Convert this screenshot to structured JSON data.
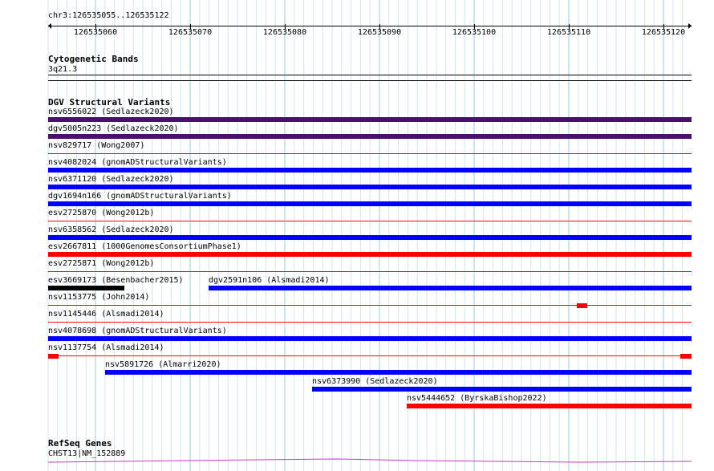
{
  "ruler": {
    "location": "chr3:126535055..126535122",
    "ticks": [
      "126535060",
      "126535070",
      "126535080",
      "126535090",
      "126535100",
      "126535110",
      "126535120"
    ]
  },
  "cytoband": {
    "title": "Cytogenetic Bands",
    "band": "3q21.3"
  },
  "dgv": {
    "title": "DGV Structural Variants",
    "features": [
      {
        "label": "nsv6556022 (Sedlazeck2020)",
        "color": "#4b0f6e",
        "style": "thick"
      },
      {
        "label": "dgv5005n223 (Sedlazeck2020)",
        "color": "#4b0f6e",
        "style": "thick"
      },
      {
        "label": "nsv829717 (Wong2007)",
        "color": "#ff0000",
        "style": "thin"
      },
      {
        "label": "nsv4082024 (gnomADStructuralVariants)",
        "color": "#0000ff",
        "style": "thick"
      },
      {
        "label": "nsv6371120 (Sedlazeck2020)",
        "color": "#0000ff",
        "style": "thick"
      },
      {
        "label": "dgv1694n166 (gnomADStructuralVariants)",
        "color": "#0000ff",
        "style": "thick"
      },
      {
        "label": "esv2725870 (Wong2012b)",
        "color": "#ff0000",
        "style": "thin"
      },
      {
        "label": "nsv6358562 (Sedlazeck2020)",
        "color": "#0000ff",
        "style": "thick"
      },
      {
        "label": "esv2667811 (1000GenomesConsortiumPhase1)",
        "color": "#ff0000",
        "style": "thick"
      },
      {
        "label": "esv2725871 (Wong2012b)",
        "color": "#ff0000",
        "style": "thin"
      },
      {
        "label": "esv3669173 (Besenbacher2015)",
        "color": "#000000",
        "style": "thick"
      },
      {
        "label": "dgv2591n106 (Alsmadi2014)",
        "color": "#0000ff",
        "style": "thick"
      },
      {
        "label": "nsv1153775 (John2014)",
        "color": "#ff0000",
        "style": "thin-end"
      },
      {
        "label": "nsv1145446 (Alsmadi2014)",
        "color": "#ff0000",
        "style": "thin"
      },
      {
        "label": "nsv4078698 (gnomADStructuralVariants)",
        "color": "#0000ff",
        "style": "thick"
      },
      {
        "label": "nsv1137754 (Alsmadi2014)",
        "color": "#ff0000",
        "style": "thin-ends"
      },
      {
        "label": "nsv5891726 (Almarri2020)",
        "color": "#0000ff",
        "style": "thick"
      },
      {
        "label": "nsv6373990 (Sedlazeck2020)",
        "color": "#0000ff",
        "style": "thick"
      },
      {
        "label": "nsv5444652 (ByrskaBishop2022)",
        "color": "#ff0000",
        "style": "thick"
      }
    ]
  },
  "refseq": {
    "title": "RefSeq Genes",
    "gene": "CHST13|NM_152889",
    "color": "#cc33cc"
  }
}
